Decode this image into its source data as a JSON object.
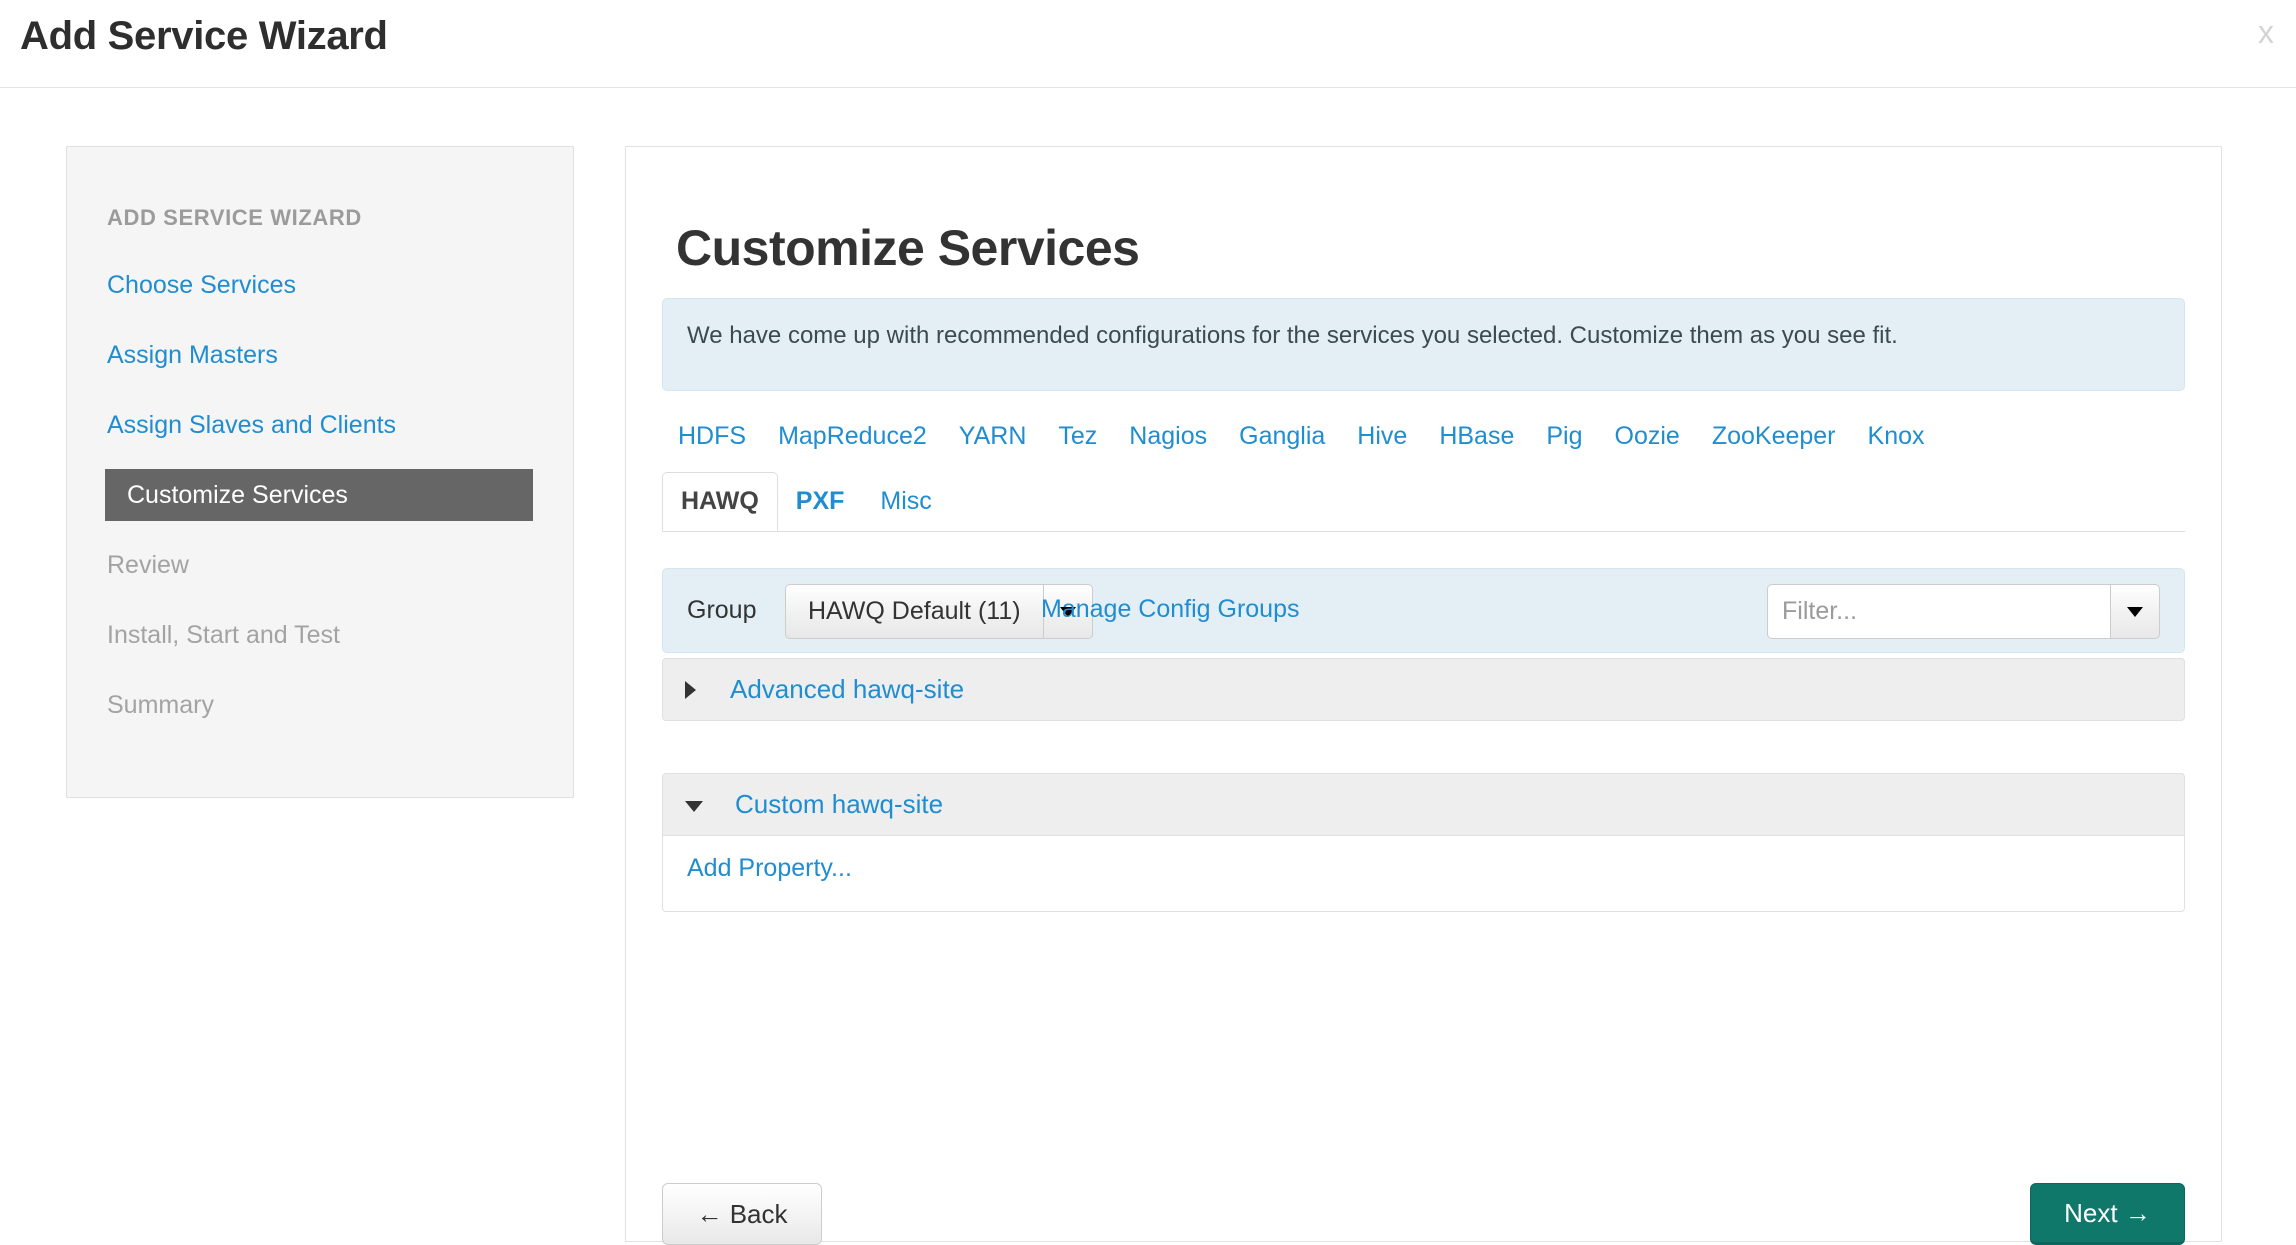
{
  "window": {
    "title": "Add Service Wizard",
    "close_label": "x"
  },
  "sidebar": {
    "heading": "ADD SERVICE WIZARD",
    "items": [
      {
        "label": "Choose Services",
        "state": "link"
      },
      {
        "label": "Assign Masters",
        "state": "link"
      },
      {
        "label": "Assign Slaves and Clients",
        "state": "link"
      },
      {
        "label": "Customize Services",
        "state": "active"
      },
      {
        "label": "Review",
        "state": "disabled"
      },
      {
        "label": "Install, Start and Test",
        "state": "disabled"
      },
      {
        "label": "Summary",
        "state": "disabled"
      }
    ]
  },
  "main": {
    "title": "Customize Services",
    "info_banner": "We have come up with recommended configurations for the services you selected. Customize them as you see fit.",
    "service_tabs": [
      {
        "label": "HDFS"
      },
      {
        "label": "MapReduce2"
      },
      {
        "label": "YARN"
      },
      {
        "label": "Tez"
      },
      {
        "label": "Nagios"
      },
      {
        "label": "Ganglia"
      },
      {
        "label": "Hive"
      },
      {
        "label": "HBase"
      },
      {
        "label": "Pig"
      },
      {
        "label": "Oozie"
      },
      {
        "label": "ZooKeeper"
      },
      {
        "label": "Knox"
      }
    ],
    "sub_tabs": [
      {
        "label": "HAWQ",
        "state": "active"
      },
      {
        "label": "PXF",
        "state": "bold"
      },
      {
        "label": "Misc",
        "state": "link"
      }
    ],
    "group_bar": {
      "label": "Group",
      "selected_group": "HAWQ Default (11)",
      "manage_link": "Manage Config Groups",
      "filter_placeholder": "Filter...",
      "filter_value": ""
    },
    "accordions": [
      {
        "title": "Advanced hawq-site",
        "expanded": false
      },
      {
        "title": "Custom hawq-site",
        "expanded": true,
        "add_property_label": "Add Property..."
      }
    ],
    "footer": {
      "back_label": "← Back",
      "next_label": "Next →"
    }
  },
  "icons": {
    "close": "close-icon",
    "caret_down": "chevron-down-icon",
    "triangle_right": "triangle-right-icon",
    "triangle_down": "triangle-down-icon"
  },
  "colors": {
    "link_blue": "#1f8dd0",
    "active_sidebar_bg": "#666666",
    "info_banner_bg": "#e3eff5",
    "next_button_bg": "#10776b",
    "accordion_header_bg": "#eeeeee"
  }
}
